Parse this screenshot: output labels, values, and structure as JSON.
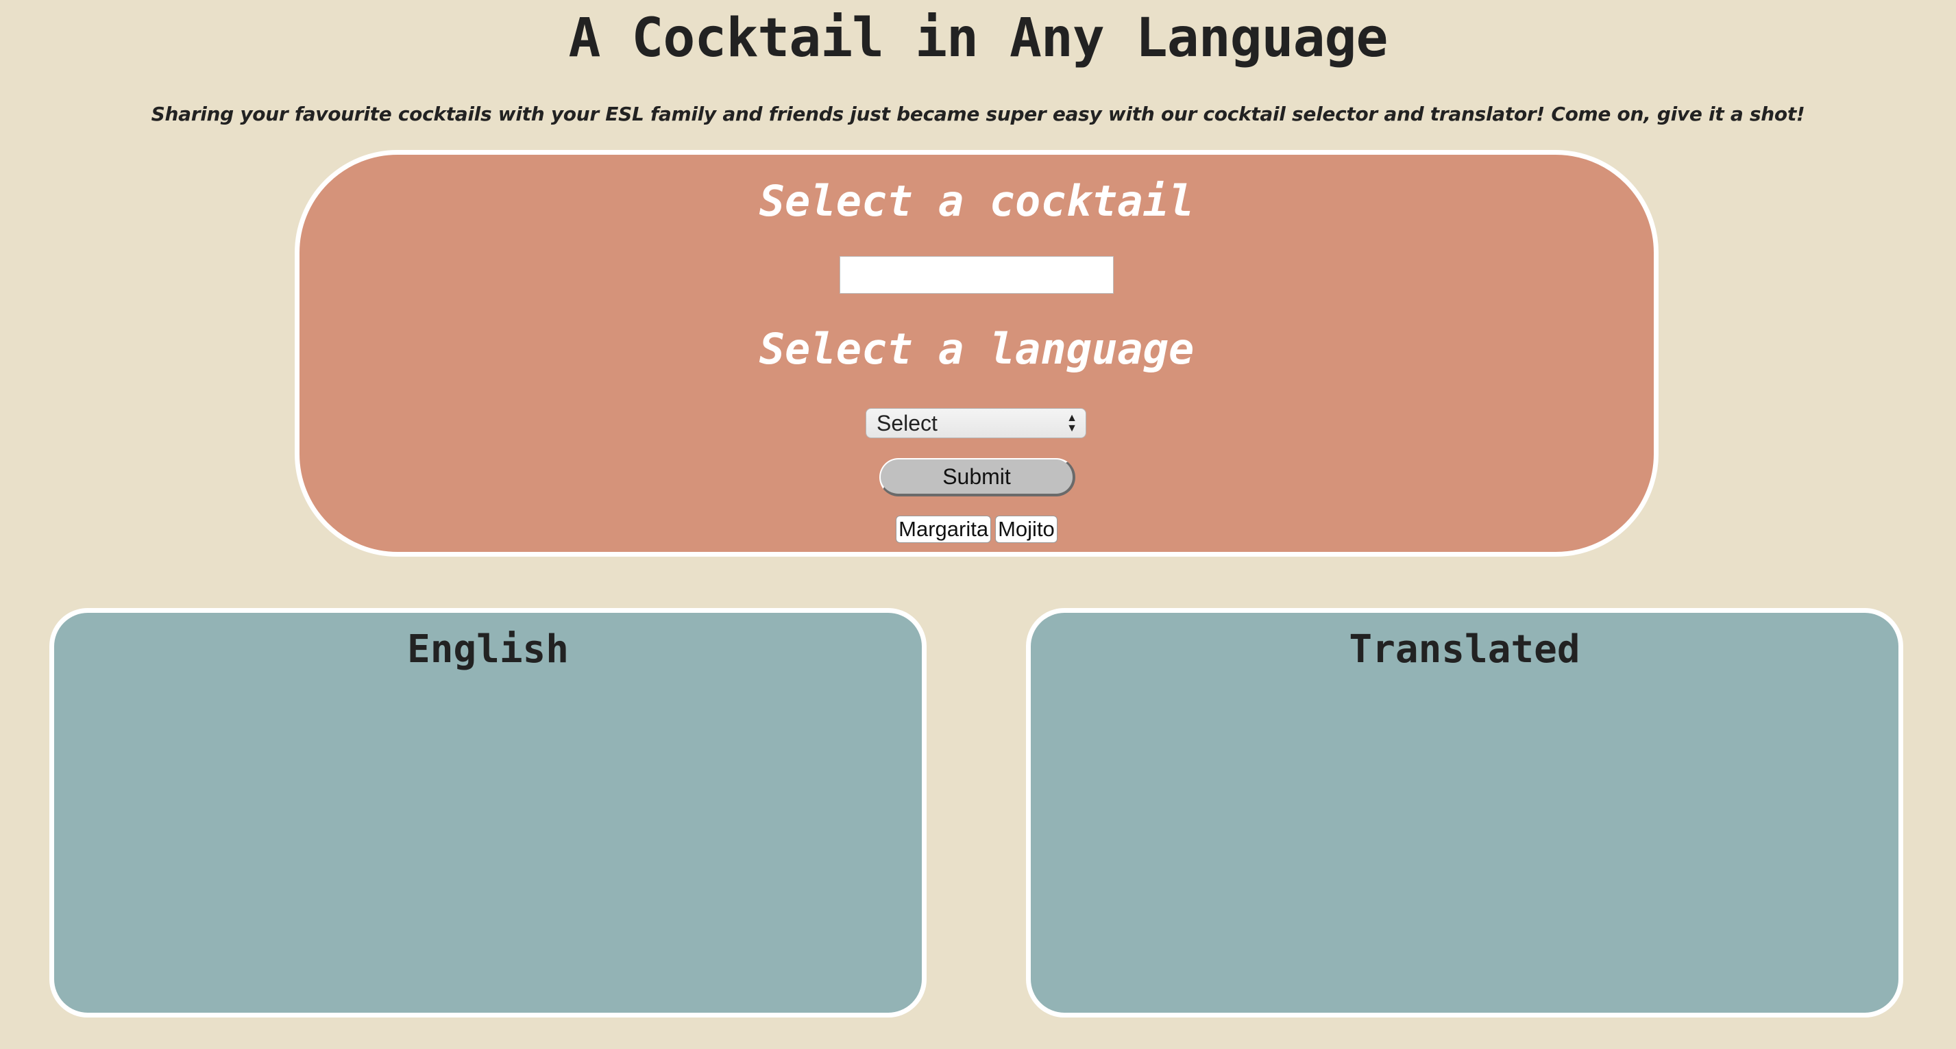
{
  "header": {
    "title": "A Cocktail in Any Language",
    "subtitle": "Sharing your favourite cocktails with your ESL family and friends just became super easy with our cocktail selector and translator! Come on, give it a shot!"
  },
  "selector": {
    "cocktail_heading": "Select a cocktail",
    "cocktail_input_value": "",
    "language_heading": "Select a language",
    "language_selected": "Select",
    "submit_label": "Submit",
    "quick_picks": [
      "Margarita",
      "Mojito"
    ]
  },
  "results": {
    "english_heading": "English",
    "english_content": "",
    "translated_heading": "Translated",
    "translated_content": ""
  },
  "colors": {
    "background": "#e9e0c9",
    "selector_panel": "#d5937a",
    "result_panel": "#93b3b5",
    "panel_border": "#ffffff",
    "submit_button": "#c0c0c0"
  }
}
